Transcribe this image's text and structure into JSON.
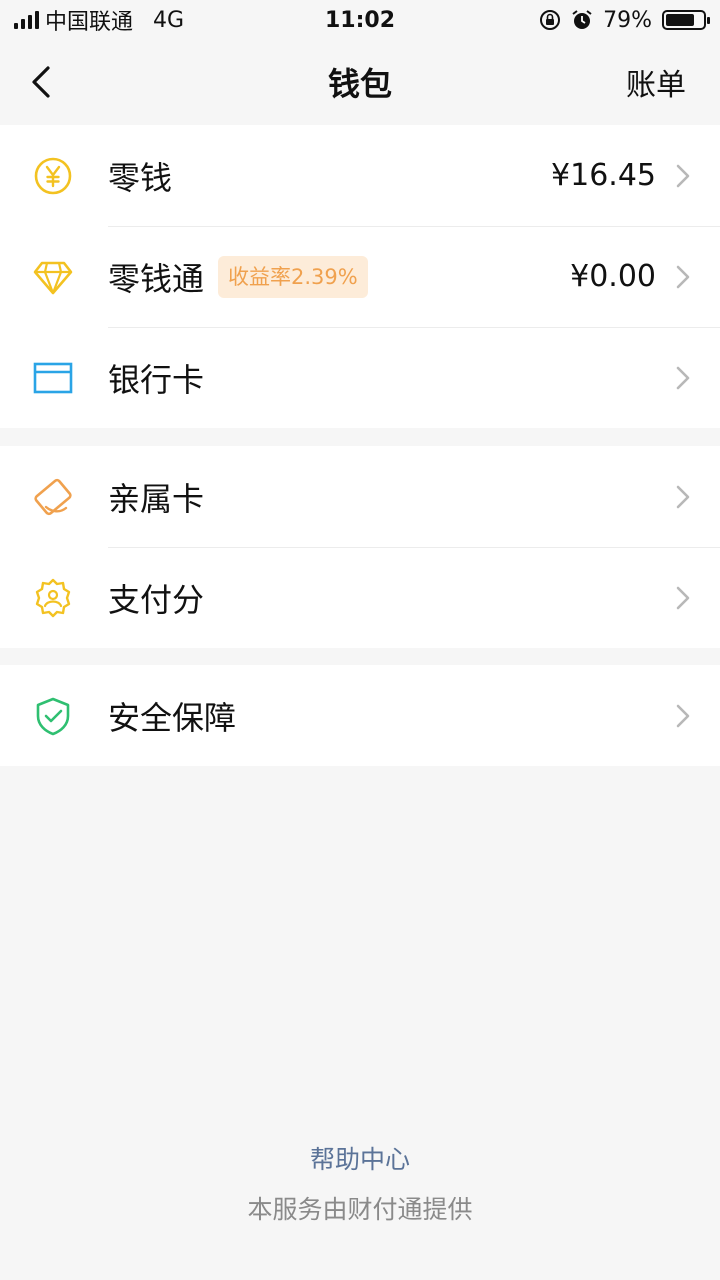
{
  "status_bar": {
    "carrier": "中国联通",
    "network": "4G",
    "time": "11:02",
    "battery": "79%",
    "battery_level": 0.79
  },
  "nav": {
    "title": "钱包",
    "right_action": "账单"
  },
  "groups": [
    [
      {
        "icon": "yuan-coin-icon",
        "label": "零钱",
        "value": "¥16.45"
      },
      {
        "icon": "diamond-icon",
        "label": "零钱通",
        "badge": "收益率2.39%",
        "value": "¥0.00"
      },
      {
        "icon": "bank-card-icon",
        "label": "银行卡"
      }
    ],
    [
      {
        "icon": "family-card-icon",
        "label": "亲属卡"
      },
      {
        "icon": "pay-score-icon",
        "label": "支付分"
      }
    ],
    [
      {
        "icon": "shield-check-icon",
        "label": "安全保障"
      }
    ]
  ],
  "footer": {
    "help": "帮助中心",
    "provider": "本服务由财付通提供"
  },
  "colors": {
    "yellow": "#f3c221",
    "blue": "#2aa4e6",
    "orange": "#f0a14e",
    "green": "#2fbf71",
    "link": "#5b7398",
    "badge_bg": "#fdecd9"
  }
}
